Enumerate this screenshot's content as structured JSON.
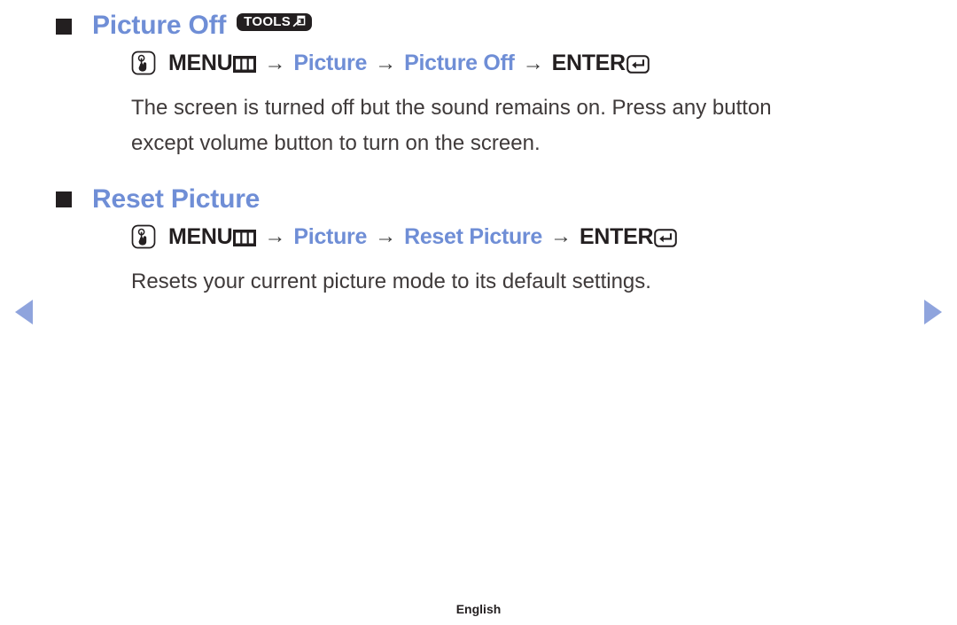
{
  "page": {
    "language_footer": "English",
    "accent_blue": "#6f8ed6",
    "ink": "#231f20",
    "body_ink": "#3f3a3a",
    "arrow_color": "#8fa4dd"
  },
  "navigation": {
    "prev_label": "previous page",
    "next_label": "next page"
  },
  "sections": [
    {
      "title": "Picture Off",
      "badge": {
        "label": "TOOLS",
        "icon": "tools-arrow-icon"
      },
      "path": {
        "icon": "press-button-hand-icon",
        "key_label": "MENU",
        "key_glyph": "menu-bars-icon",
        "arrow": "→",
        "steps": [
          "Picture",
          "Picture Off"
        ],
        "enter_label": "ENTER",
        "enter_glyph": "enter-key-icon"
      },
      "description": "The screen is turned off but the sound remains on. Press any button except volume button to turn on the screen."
    },
    {
      "title": "Reset Picture",
      "badge": null,
      "path": {
        "icon": "press-button-hand-icon",
        "key_label": "MENU",
        "key_glyph": "menu-bars-icon",
        "arrow": "→",
        "steps": [
          "Picture",
          "Reset Picture"
        ],
        "enter_label": "ENTER",
        "enter_glyph": "enter-key-icon"
      },
      "description": "Resets your current picture mode to its default settings."
    }
  ]
}
